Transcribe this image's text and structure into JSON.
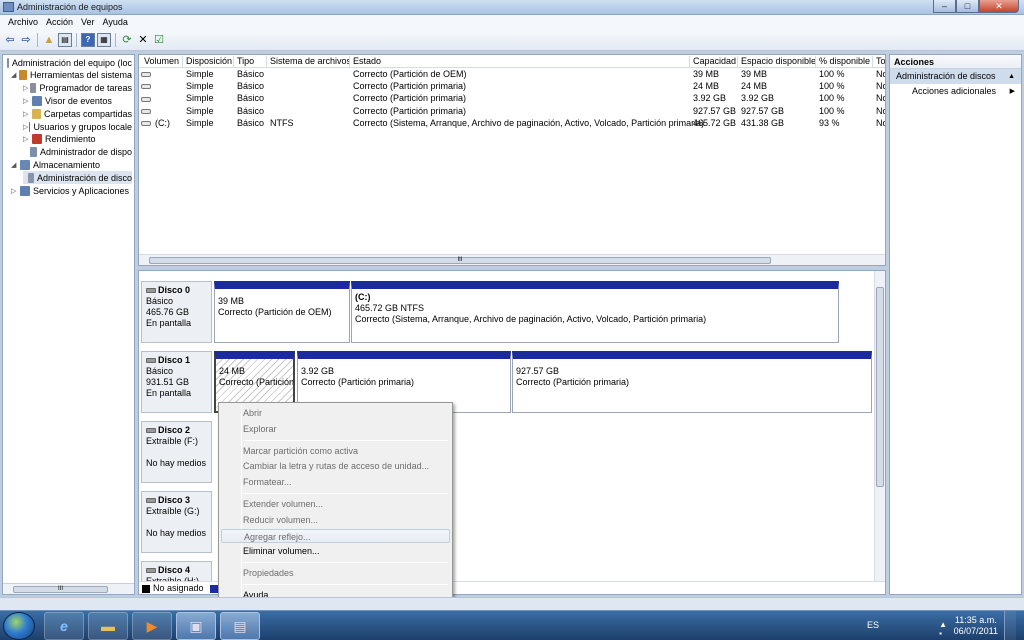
{
  "window": {
    "title": "Administración de equipos",
    "min": "–",
    "max": "□",
    "close": "✕"
  },
  "menu": [
    "Archivo",
    "Acción",
    "Ver",
    "Ayuda"
  ],
  "tree": {
    "items": [
      {
        "label": "Administración del equipo (loc",
        "level": 0,
        "exp": "",
        "icon": "computer-icon",
        "color": "#7d8fa8"
      },
      {
        "label": "Herramientas del sistema",
        "level": 1,
        "exp": "◢",
        "icon": "tools-icon",
        "color": "#c98a2b"
      },
      {
        "label": "Programador de tareas",
        "level": 2,
        "exp": "▷",
        "icon": "clock-icon",
        "color": "#8a8f99"
      },
      {
        "label": "Visor de eventos",
        "level": 2,
        "exp": "▷",
        "icon": "event-viewer-icon",
        "color": "#5f7fae"
      },
      {
        "label": "Carpetas compartidas",
        "level": 2,
        "exp": "▷",
        "icon": "shared-folder-icon",
        "color": "#d8b450"
      },
      {
        "label": "Usuarios y grupos locale",
        "level": 2,
        "exp": "▷",
        "icon": "users-icon",
        "color": "#4a76b8"
      },
      {
        "label": "Rendimiento",
        "level": 2,
        "exp": "▷",
        "icon": "performance-icon",
        "color": "#c0392b"
      },
      {
        "label": "Administrador de dispo",
        "level": 2,
        "exp": "",
        "icon": "device-manager-icon",
        "color": "#7d8fa8"
      },
      {
        "label": "Almacenamiento",
        "level": 1,
        "exp": "◢",
        "icon": "storage-icon",
        "color": "#6a87b1"
      },
      {
        "label": "Administración de disco",
        "level": 2,
        "exp": "",
        "icon": "disk-management-icon",
        "color": "#8795a8",
        "selected": true
      },
      {
        "label": "Servicios y Aplicaciones",
        "level": 1,
        "exp": "▷",
        "icon": "services-icon",
        "color": "#5f7fae"
      }
    ],
    "scroll_label": "III"
  },
  "volumes": {
    "headers": [
      "Volumen",
      "Disposición",
      "Tipo",
      "Sistema de archivos",
      "Estado",
      "Capacidad",
      "Espacio disponible",
      "% disponible",
      "To"
    ],
    "rows": [
      {
        "volumen": "",
        "disp": "Simple",
        "tipo": "Básico",
        "fs": "",
        "estado": "Correcto (Partición de OEM)",
        "cap": "39 MB",
        "libre": "39 MB",
        "pct": "100 %",
        "to": "No"
      },
      {
        "volumen": "",
        "disp": "Simple",
        "tipo": "Básico",
        "fs": "",
        "estado": "Correcto (Partición primaria)",
        "cap": "24 MB",
        "libre": "24 MB",
        "pct": "100 %",
        "to": "No"
      },
      {
        "volumen": "",
        "disp": "Simple",
        "tipo": "Básico",
        "fs": "",
        "estado": "Correcto (Partición primaria)",
        "cap": "3.92 GB",
        "libre": "3.92 GB",
        "pct": "100 %",
        "to": "No"
      },
      {
        "volumen": "",
        "disp": "Simple",
        "tipo": "Básico",
        "fs": "",
        "estado": "Correcto (Partición primaria)",
        "cap": "927.57 GB",
        "libre": "927.57 GB",
        "pct": "100 %",
        "to": "No"
      },
      {
        "volumen": "(C:)",
        "disp": "Simple",
        "tipo": "Básico",
        "fs": "NTFS",
        "estado": "Correcto (Sistema, Arranque, Archivo de paginación, Activo, Volcado, Partición primaria)",
        "cap": "465.72 GB",
        "libre": "431.38 GB",
        "pct": "93 %",
        "to": "No"
      }
    ],
    "scroll_label": "III"
  },
  "disks": [
    {
      "name": "Disco 0",
      "type": "Básico",
      "size": "465.76 GB",
      "state": "En pantalla",
      "parts": [
        {
          "name": "",
          "size": "39 MB",
          "status": "Correcto (Partición de OEM)"
        },
        {
          "name": "(C:)",
          "size": "465.72 GB NTFS",
          "status": "Correcto (Sistema, Arranque, Archivo de paginación, Activo, Volcado, Partición primaria)"
        }
      ]
    },
    {
      "name": "Disco 1",
      "type": "Básico",
      "size": "931.51 GB",
      "state": "En pantalla",
      "parts": [
        {
          "name": "",
          "size": "24 MB",
          "status": "Correcto (Partición"
        },
        {
          "name": "",
          "size": "3.92 GB",
          "status": "Correcto (Partición primaria)"
        },
        {
          "name": "",
          "size": "927.57 GB",
          "status": "Correcto (Partición primaria)"
        }
      ]
    },
    {
      "name": "Disco 2",
      "type": "Extraíble (F:)",
      "state": "No hay medios"
    },
    {
      "name": "Disco 3",
      "type": "Extraíble (G:)",
      "state": "No hay medios"
    },
    {
      "name": "Disco 4",
      "type": "Extraíble (H:)"
    }
  ],
  "legend": {
    "unallocated": "No asignado"
  },
  "context_menu": [
    {
      "label": "Abrir",
      "enabled": false
    },
    {
      "label": "Explorar",
      "enabled": false
    },
    {
      "sep": true
    },
    {
      "label": "Marcar partición como activa",
      "enabled": false
    },
    {
      "label": "Cambiar la letra y rutas de acceso de unidad...",
      "enabled": false
    },
    {
      "label": "Formatear...",
      "enabled": false
    },
    {
      "sep": true
    },
    {
      "label": "Extender volumen...",
      "enabled": false
    },
    {
      "label": "Reducir volumen...",
      "enabled": false
    },
    {
      "label": "Agregar reflejo...",
      "enabled": false,
      "highlight": true
    },
    {
      "label": "Eliminar volumen...",
      "enabled": true
    },
    {
      "sep": true
    },
    {
      "label": "Propiedades",
      "enabled": false
    },
    {
      "sep": true
    },
    {
      "label": "Ayuda",
      "enabled": true
    }
  ],
  "actions": {
    "title": "Acciones",
    "section": "Administración de discos",
    "item": "Acciones adicionales"
  },
  "taskbar": {
    "lang": "ES",
    "time": "11:35 a.m.",
    "date": "06/07/2011"
  },
  "colors": {
    "partition_header": "#1b2a9c",
    "selection": "#cfdcec"
  }
}
